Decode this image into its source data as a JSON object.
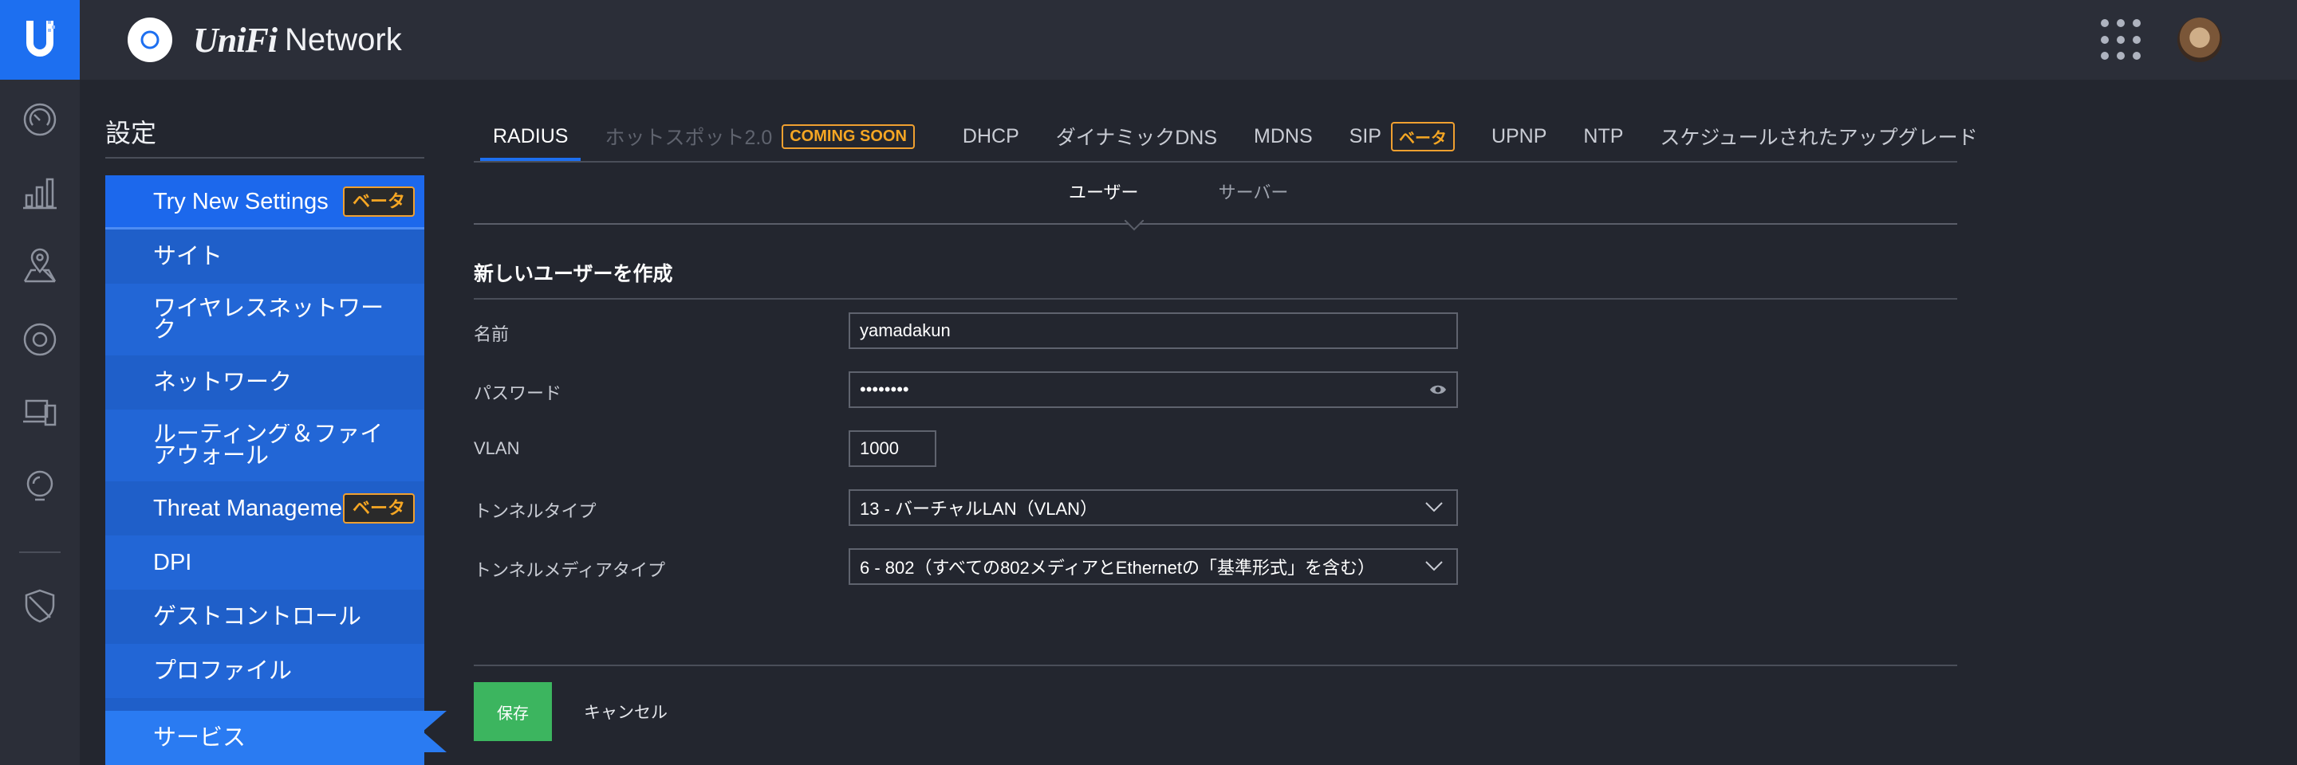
{
  "header": {
    "brand": "UniFi",
    "product": "Network"
  },
  "settings": {
    "title": "設定"
  },
  "sidebar": {
    "items": [
      {
        "label": "Try New Settings",
        "badge": "ベータ"
      },
      {
        "label": "サイト"
      },
      {
        "label": "ワイヤレスネットワーク"
      },
      {
        "label": "ネットワーク"
      },
      {
        "label": "ルーティング＆ファイアウォール"
      },
      {
        "label": "Threat Management",
        "badge": "ベータ"
      },
      {
        "label": "DPI"
      },
      {
        "label": "ゲストコントロール"
      },
      {
        "label": "プロファイル"
      },
      {
        "label": "サービス"
      }
    ]
  },
  "tabs": {
    "items": [
      {
        "label": "RADIUS"
      },
      {
        "label": "ホットスポット2.0",
        "badge": "COMING SOON"
      },
      {
        "label": "DHCP"
      },
      {
        "label": "ダイナミックDNS"
      },
      {
        "label": "MDNS"
      },
      {
        "label": "SIP",
        "badge": "ベータ"
      },
      {
        "label": "UPNP"
      },
      {
        "label": "NTP"
      },
      {
        "label": "スケジュールされたアップグレード"
      }
    ]
  },
  "subtabs": {
    "items": [
      {
        "label": "ユーザー"
      },
      {
        "label": "サーバー"
      }
    ]
  },
  "form": {
    "title": "新しいユーザーを作成",
    "name_label": "名前",
    "name_value": "yamadakun",
    "password_label": "パスワード",
    "password_value": "••••••••",
    "vlan_label": "VLAN",
    "vlan_value": "1000",
    "tunnel_type_label": "トンネルタイプ",
    "tunnel_type_value": "13 - バーチャルLAN（VLAN）",
    "tunnel_media_label": "トンネルメディアタイプ",
    "tunnel_media_value": "6 - 802（すべての802メディアとEthernetの「基準形式」を含む）"
  },
  "actions": {
    "save": "保存",
    "cancel": "キャンセル"
  },
  "colors": {
    "accent": "#1d6ff0",
    "sidebar": "#1f5fc9",
    "save": "#3cb55f",
    "beta_badge": "#f5a623"
  }
}
